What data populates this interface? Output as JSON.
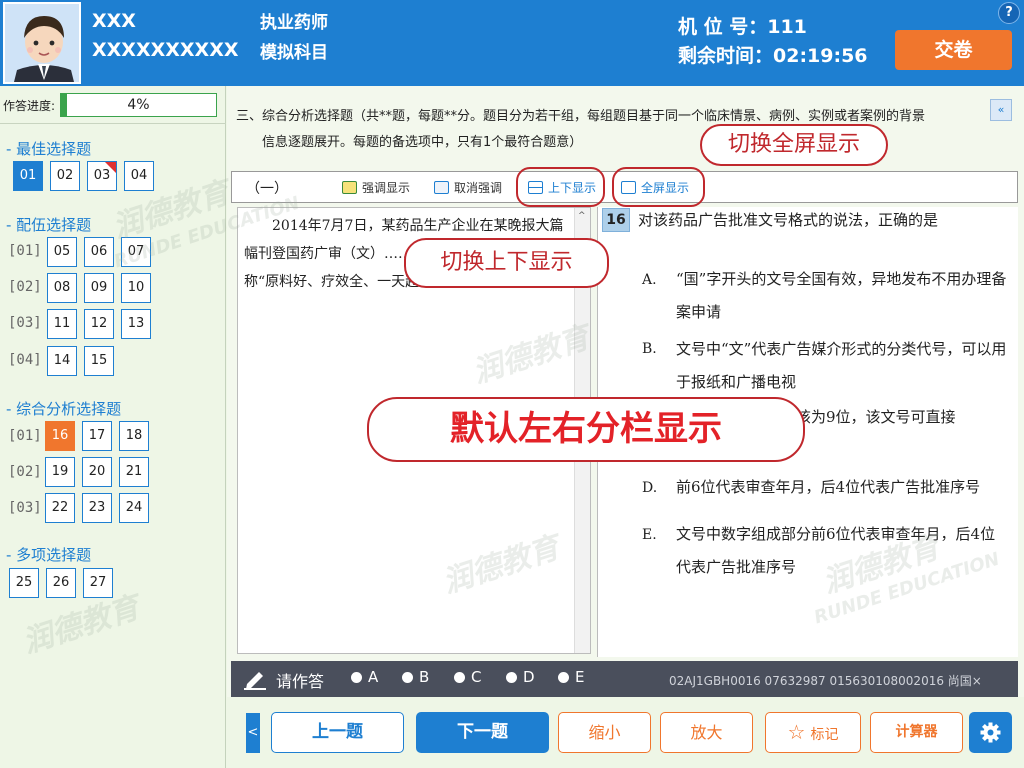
{
  "header": {
    "candidate_name": "XXX",
    "candidate_id": "XXXXXXXXXX",
    "exam_name": "执业药师",
    "exam_subject": "模拟科目",
    "seat_label": "机 位 号：111",
    "time_label": "剩余时间：02:19:56",
    "help_label": "?",
    "submit_label": "交卷"
  },
  "progress": {
    "label": "作答进度:",
    "value": 0.04,
    "text": "4%"
  },
  "sidebar": {
    "sections": [
      {
        "title": "- 最佳选择题",
        "groups": [
          {
            "label": "",
            "items": [
              "01",
              "02",
              "03",
              "04"
            ]
          }
        ]
      },
      {
        "title": "- 配伍选择题",
        "groups": [
          {
            "label": "[01]",
            "items": [
              "05",
              "06",
              "07"
            ]
          },
          {
            "label": "[02]",
            "items": [
              "08",
              "09",
              "10"
            ]
          },
          {
            "label": "[03]",
            "items": [
              "11",
              "12",
              "13"
            ]
          },
          {
            "label": "[04]",
            "items": [
              "14",
              "15"
            ]
          }
        ]
      },
      {
        "title": "- 综合分析选择题",
        "groups": [
          {
            "label": "[01]",
            "items": [
              "16",
              "17",
              "18"
            ]
          },
          {
            "label": "[02]",
            "items": [
              "19",
              "20",
              "21"
            ]
          },
          {
            "label": "[03]",
            "items": [
              "22",
              "23",
              "24"
            ]
          }
        ]
      },
      {
        "title": "- 多项选择题",
        "groups": [
          {
            "label": "",
            "items": [
              "25",
              "26",
              "27"
            ]
          }
        ]
      }
    ]
  },
  "instructions": {
    "line1": "三、综合分析选择题（共**题，每题**分。题目分为若干组，每组题目基于同一个临床情景、病例、实例或者案例的背景",
    "line2": "信息逐题展开。每题的备选项中，只有1个最符合题意）",
    "collapse_icon": "«"
  },
  "toolbar": {
    "group_label": "（一）",
    "highlight_label": "强调显示",
    "unhighlight_label": "取消强调",
    "vertical_label": "上下显示",
    "fullscreen_label": "全屏显示"
  },
  "passage": {
    "text": "2014年7月7日，某药品生产企业在某晚报大篇幅刊登国药广审（文）……号药品广告，该广告宣称“原料好、疗效全、一天起效，三十天痊愈”。",
    "scroll_up": "^"
  },
  "question": {
    "number": "16",
    "stem": "对该药品广告批准文号格式的说法，正确的是",
    "options": [
      {
        "letter": "A.",
        "text": "“国”字开头的文号全国有效，异地发布不用办理备案申请"
      },
      {
        "letter": "B.",
        "text": "文号中“文”代表广告媒介形式的分类代号，可以用于报纸和广播电视"
      },
      {
        "letter": "C.",
        "text": "文号中数字部分应该为9位，该文号可直接"
      },
      {
        "letter": "D.",
        "text": "前6位代表审查年月，后4位代表广告批准序号"
      },
      {
        "letter": "E.",
        "text": "文号中数字组成部分前6位代表审查年月，后4位代表广告批准序号"
      }
    ]
  },
  "answer_bar": {
    "label": "请作答",
    "options": [
      "A",
      "B",
      "C",
      "D",
      "E"
    ],
    "watermark": "02AJ1GBH0016  07632987 015630108002016 尚国×"
  },
  "bottom": {
    "side_arrow": "<",
    "prev_label": "上一题",
    "next_label": "下一题",
    "zoom_out_label": "缩小",
    "zoom_in_label": "放大",
    "mark_label": "标记",
    "calculator_label": "计算器"
  },
  "annotations": {
    "fullscreen_note": "切换全屏显示",
    "vertical_note": "切换上下显示",
    "default_note": "默认左右分栏显示"
  },
  "watermarks": {
    "brand_cn": "润德教育",
    "brand_en": "RUNDE EDUCATION"
  },
  "colors": {
    "brand_blue": "#1e7fd1",
    "accent_orange": "#f0762d",
    "annotation_red": "#c0282d"
  }
}
